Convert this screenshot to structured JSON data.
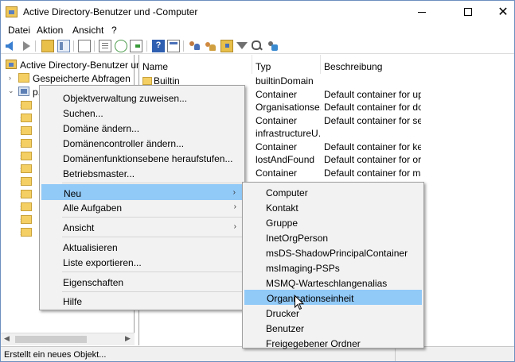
{
  "window": {
    "title": "Active Directory-Benutzer und -Computer",
    "minimize": "–",
    "maximize": "☐",
    "close": "✕"
  },
  "menubar": {
    "items": [
      "Datei",
      "Aktion",
      "Ansicht",
      "?"
    ]
  },
  "toolbar": {
    "icons": [
      "back-icon",
      "forward-icon",
      "folder-up-icon",
      "show-pane-icon",
      "document-icon",
      "list-icon",
      "refresh-icon",
      "export-icon",
      "help-icon",
      "properties-icon",
      "users-icon",
      "group-icon",
      "ou-icon",
      "filter-icon",
      "find-icon",
      "delegate-icon"
    ]
  },
  "tree": {
    "root": "Active Directory-Benutzer und -",
    "saved_queries": "Gespeicherte Abfragen",
    "domain": "p..."
  },
  "list": {
    "columns": [
      "Name",
      "Typ",
      "Beschreibung"
    ],
    "rows": [
      {
        "name": "Builtin",
        "type": "builtinDomain",
        "desc": ""
      },
      {
        "name": "",
        "type": "Container",
        "desc": "Default container for up..."
      },
      {
        "name": "",
        "type": "Organisationse...",
        "desc": "Default container for do..."
      },
      {
        "name": "",
        "type": "Container",
        "desc": "Default container for sec..."
      },
      {
        "name": "",
        "type": "infrastructureU...",
        "desc": ""
      },
      {
        "name": "",
        "type": "Container",
        "desc": "Default container for ke..."
      },
      {
        "name": "",
        "type": "lostAndFound",
        "desc": "Default container for or..."
      },
      {
        "name": "",
        "type": "Container",
        "desc": "Default container for ma..."
      }
    ]
  },
  "context_menu": {
    "items": [
      {
        "label": "Objektverwaltung zuweisen...",
        "submenu": false
      },
      {
        "label": "Suchen...",
        "submenu": false
      },
      {
        "label": "Domäne ändern...",
        "submenu": false
      },
      {
        "label": "Domänencontroller ändern...",
        "submenu": false
      },
      {
        "label": "Domänenfunktionsebene heraufstufen...",
        "submenu": false
      },
      {
        "label": "Betriebsmaster...",
        "submenu": false
      },
      {
        "label": "Neu",
        "submenu": true,
        "highlighted": true
      },
      {
        "label": "Alle Aufgaben",
        "submenu": true
      },
      {
        "label": "Ansicht",
        "submenu": true
      },
      {
        "label": "Aktualisieren",
        "submenu": false
      },
      {
        "label": "Liste exportieren...",
        "submenu": false
      },
      {
        "label": "Eigenschaften",
        "submenu": false
      },
      {
        "label": "Hilfe",
        "submenu": false
      }
    ],
    "submenu_arrow": "›"
  },
  "new_submenu": {
    "items": [
      "Computer",
      "Kontakt",
      "Gruppe",
      "InetOrgPerson",
      "msDS-ShadowPrincipalContainer",
      "msImaging-PSPs",
      "MSMQ-Warteschlangenalias",
      "Organisationseinheit",
      "Drucker",
      "Benutzer",
      "Freigegebener Ordner"
    ],
    "highlighted_index": 7
  },
  "status": {
    "text": "Erstellt ein neues Objekt..."
  },
  "colors": {
    "highlight": "#91c9f7",
    "menu_bg": "#f2f2f2",
    "folder": "#f4cf63"
  }
}
